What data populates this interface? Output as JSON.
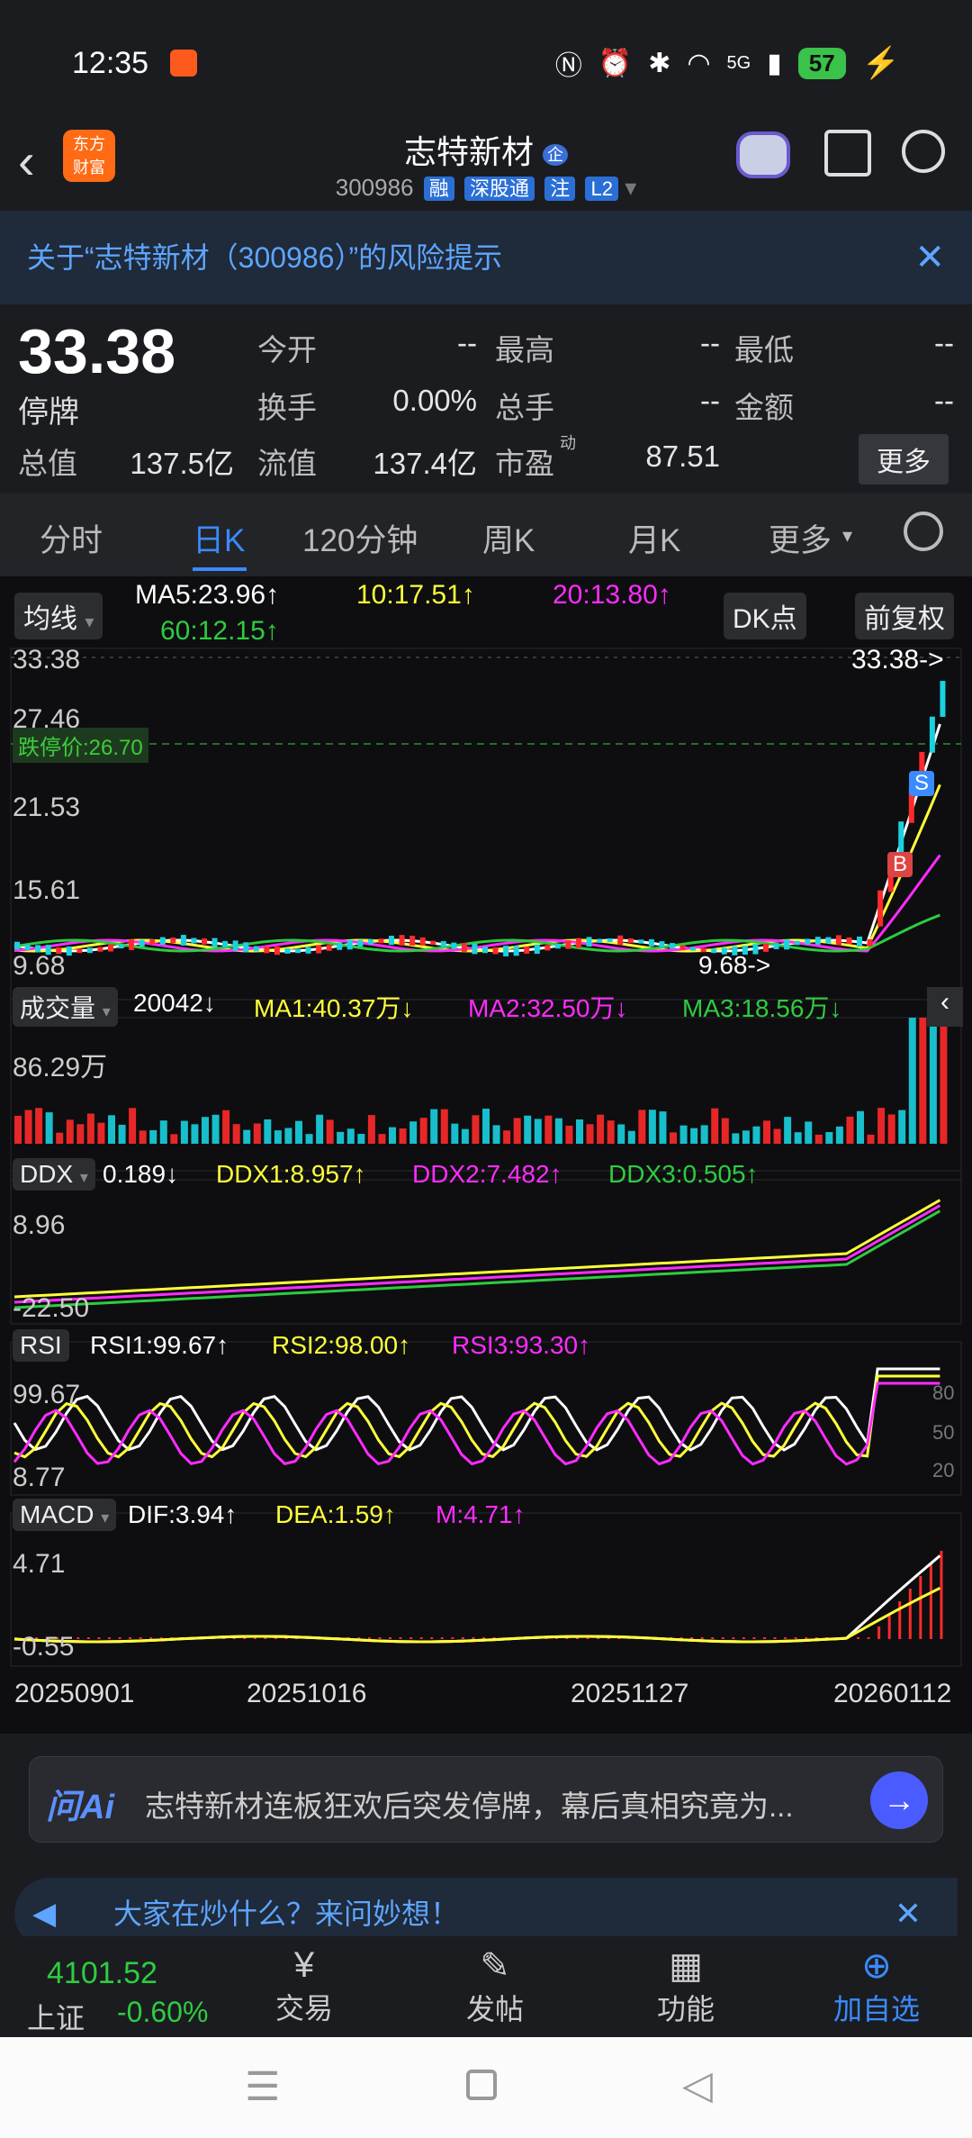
{
  "status_bar": {
    "time": "12:35",
    "signal": "5G",
    "battery": "57"
  },
  "header": {
    "back": "<",
    "app_logo_line1": "东方",
    "app_logo_line2": "财富",
    "title": "志特新材",
    "title_badge": "企",
    "code": "300986",
    "tags": [
      "融",
      "深股通",
      "注",
      "L2"
    ]
  },
  "risk_banner": {
    "text": "关于“志特新材（300986）”的风险提示"
  },
  "quote": {
    "price": "33.38",
    "status": "停牌",
    "jinkai_label": "今开",
    "jinkai": "--",
    "zuigao_label": "最高",
    "zuigao": "--",
    "zuidi_label": "最低",
    "zuidi": "--",
    "huanshou_label": "换手",
    "huanshou": "0.00%",
    "zongshou_label": "总手",
    "zongshou": "--",
    "jine_label": "金额",
    "jine": "--",
    "zongzhi_label": "总值",
    "zongzhi": "137.5亿",
    "liuzhi_label": "流值",
    "liuzhi": "137.4亿",
    "shiying_label": "市盈",
    "shiying_sup": "动",
    "shiying": "87.51",
    "more": "更多"
  },
  "tabs": [
    "分时",
    "日K",
    "120分钟",
    "周K",
    "月K",
    "更多"
  ],
  "chart": {
    "ma_button": "均线",
    "ma5": "MA5:23.96↑",
    "ma10": "10:17.51↑",
    "ma20": "20:13.80↑",
    "ma60": "60:12.15↑",
    "dk_button": "DK点",
    "fq_button": "前复权",
    "y_labels": [
      "33.38",
      "27.46",
      "21.53",
      "15.61",
      "9.68"
    ],
    "limit_down": "跌停价:26.70",
    "last_price_tag": "33.38->",
    "low_tag": "9.68->",
    "vol_button": "成交量",
    "vol_value": "20042↓",
    "vol_ma1": "MA1:40.37万↓",
    "vol_ma2": "MA2:32.50万↓",
    "vol_ma3": "MA3:18.56万↓",
    "vol_max": "86.29万",
    "ddx_button": "DDX",
    "ddx_value": "0.189↓",
    "ddx1": "DDX1:8.957↑",
    "ddx2": "DDX2:7.482↑",
    "ddx3": "DDX3:0.505↑",
    "ddx_top": "8.96",
    "ddx_bottom": "-22.50",
    "rsi_button": "RSI",
    "rsi1": "RSI1:99.67↑",
    "rsi2": "RSI2:98.00↑",
    "rsi3": "RSI3:93.30↑",
    "rsi_top": "99.67",
    "rsi_bottom": "8.77",
    "rsi_80": "80",
    "rsi_50": "50",
    "rsi_20": "20",
    "macd_button": "MACD",
    "dif": "DIF:3.94↑",
    "dea": "DEA:1.59↑",
    "m": "M:4.71↑",
    "macd_top": "4.71",
    "macd_bottom": "-0.55",
    "dates": [
      "20250901",
      "20251016",
      "20251127",
      "20260112"
    ],
    "b_marker": "B",
    "s_marker": "S"
  },
  "ai": {
    "logo": "问Ai",
    "text": "志特新材连板狂欢后突发停牌，幕后真相究竟为..."
  },
  "tip": {
    "text": "大家在炒什么？来问妙想！"
  },
  "bottom_nav": {
    "index_value": "4101.52",
    "index_name": "上证",
    "index_change": "-0.60%",
    "trade": "交易",
    "post": "发帖",
    "func": "功能",
    "watch": "加自选"
  },
  "colors": {
    "up": "#ff2a2a",
    "down": "#1ad1e0",
    "ma5": "#ffffff",
    "ma10": "#ffff3a",
    "ma20": "#ff2cff",
    "ma60": "#2ecc40",
    "accent": "#3a8bff"
  }
}
